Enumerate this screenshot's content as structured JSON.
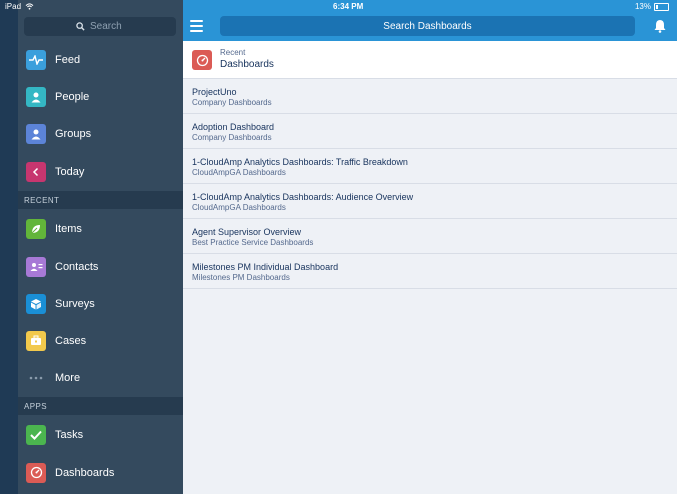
{
  "status_bar": {
    "device": "iPad",
    "time": "6:34 PM",
    "battery": "13%"
  },
  "sidebar": {
    "search_placeholder": "Search",
    "items": [
      {
        "label": "Feed",
        "icon": "feed-icon",
        "color": "#3a9fdc"
      },
      {
        "label": "People",
        "icon": "person-icon",
        "color": "#34b7c4"
      },
      {
        "label": "Groups",
        "icon": "groups-icon",
        "color": "#5c84d8"
      },
      {
        "label": "Today",
        "icon": "today-icon",
        "color": "#c7366f"
      }
    ],
    "recent_header": "RECENT",
    "recent_items": [
      {
        "label": "Items",
        "icon": "leaf-icon",
        "color": "#62b53a"
      },
      {
        "label": "Contacts",
        "icon": "contact-card-icon",
        "color": "#a779d6"
      },
      {
        "label": "Surveys",
        "icon": "cube-icon",
        "color": "#1a8fd6"
      },
      {
        "label": "Cases",
        "icon": "briefcase-icon",
        "color": "#f2c94c"
      },
      {
        "label": "More",
        "icon": "more-dots-icon",
        "color": "#8a9bab"
      }
    ],
    "apps_header": "APPS",
    "apps_items": [
      {
        "label": "Tasks",
        "icon": "checkmark-icon",
        "color": "#4bb54f"
      },
      {
        "label": "Dashboards",
        "icon": "gauge-icon",
        "color": "#db5b55"
      }
    ]
  },
  "topbar": {
    "search_label": "Search Dashboards",
    "accent": "#2a94d6"
  },
  "recent_section": {
    "small": "Recent",
    "title": "Dashboards"
  },
  "dashboards": [
    {
      "title": "ProjectUno",
      "subtitle": "Company Dashboards"
    },
    {
      "title": "Adoption Dashboard",
      "subtitle": "Company Dashboards"
    },
    {
      "title": "1-CloudAmp Analytics Dashboards: Traffic Breakdown",
      "subtitle": "CloudAmpGA Dashboards"
    },
    {
      "title": "1-CloudAmp Analytics Dashboards: Audience Overview",
      "subtitle": "CloudAmpGA Dashboards"
    },
    {
      "title": "Agent Supervisor Overview",
      "subtitle": "Best Practice Service Dashboards"
    },
    {
      "title": "Milestones PM Individual Dashboard",
      "subtitle": "Milestones PM Dashboards"
    }
  ]
}
